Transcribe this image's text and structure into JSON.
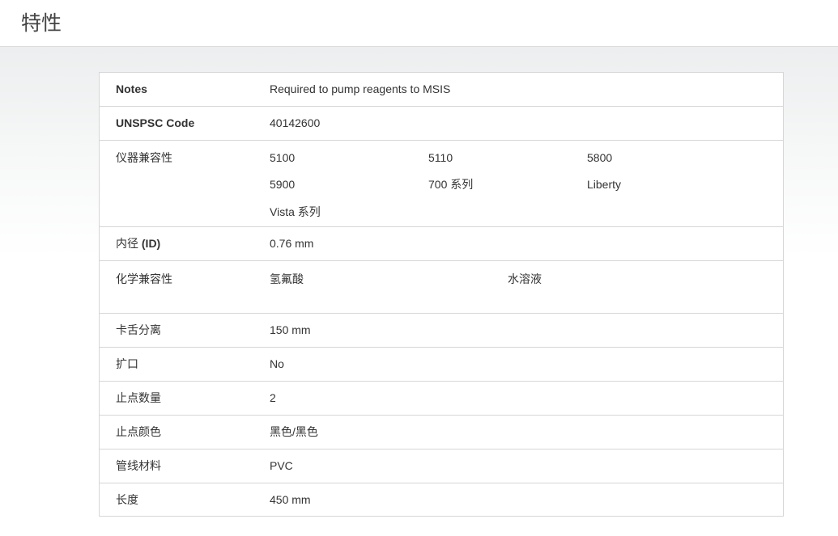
{
  "header": {
    "title": "特性"
  },
  "specs": {
    "notes": {
      "label": "Notes",
      "value": "Required to pump reagents to MSIS"
    },
    "unspsc": {
      "label": "UNSPSC Code",
      "value": "40142600"
    },
    "instrument": {
      "label": "仪器兼容性",
      "values": [
        "5100",
        "5110",
        "5800",
        "5900",
        "700 系列",
        "Liberty",
        "Vista 系列"
      ]
    },
    "inner_diameter": {
      "label_prefix": "内径 ",
      "label_bold": "(ID)",
      "value": "0.76 mm"
    },
    "chemical": {
      "label": "化学兼容性",
      "values": [
        "氢氟酸",
        "水溶液"
      ]
    },
    "clip_separation": {
      "label": "卡舌分离",
      "value": "150 mm"
    },
    "flared": {
      "label": "扩口",
      "value": "No"
    },
    "stop_count": {
      "label": "止点数量",
      "value": "2"
    },
    "stop_color": {
      "label": "止点颜色",
      "value": "黑色/黑色"
    },
    "tubing_material": {
      "label": "管线材料",
      "value": "PVC"
    },
    "length": {
      "label": "长度",
      "value": "450 mm"
    }
  }
}
